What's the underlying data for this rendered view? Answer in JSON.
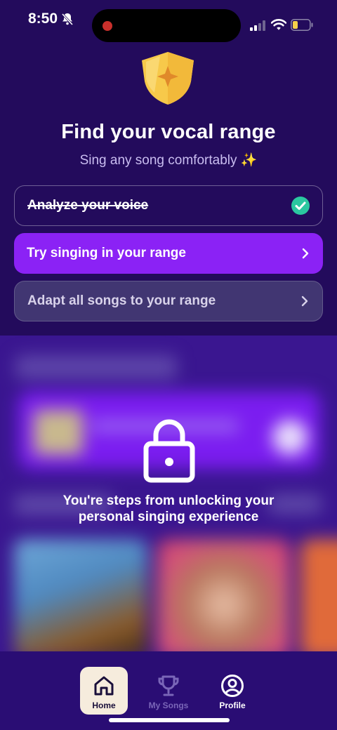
{
  "status_bar": {
    "time": "8:50",
    "icons": [
      "bell-muted-icon",
      "signal-icon",
      "wifi-icon",
      "battery-low-icon"
    ]
  },
  "header": {
    "badge_icon": "shield-star-icon",
    "title": "Find your vocal range",
    "subtitle": "Sing any song comfortably ✨"
  },
  "steps": [
    {
      "label": "Analyze your voice",
      "state": "completed",
      "icon": "check-circle-icon"
    },
    {
      "label": "Try singing in your range",
      "state": "active",
      "icon": "chevron-right-icon"
    },
    {
      "label": "Adapt all songs to your range",
      "state": "locked",
      "icon": "chevron-right-icon"
    }
  ],
  "locked_section": {
    "icon": "lock-icon",
    "message": "You're steps from unlocking your personal singing experience"
  },
  "bottom_nav": {
    "items": [
      {
        "label": "Home",
        "icon": "home-icon",
        "selected": true
      },
      {
        "label": "My Songs",
        "icon": "trophy-icon",
        "selected": false
      },
      {
        "label": "Profile",
        "icon": "person-circle-icon",
        "selected": false
      }
    ]
  },
  "colors": {
    "background": "#230b5c",
    "accent": "#8b22f5",
    "check": "#2bc7a0",
    "shield": "#f7c94a"
  }
}
